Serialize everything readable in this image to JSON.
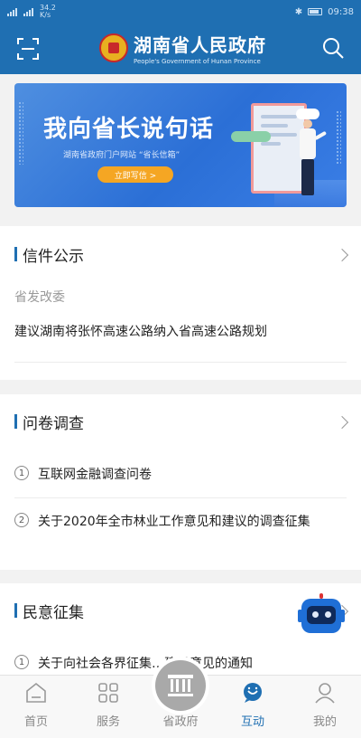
{
  "status_bar": {
    "time": "09:38",
    "left_info": "34.2 K/s"
  },
  "header": {
    "title": "湖南省人民政府",
    "subtitle": "People's Government of Hunan Province"
  },
  "banner": {
    "title": "我向省长说句话",
    "subtitle": "湖南省政府门户网站 “省长信箱”",
    "button": "立即写信 >"
  },
  "letters": {
    "title": "信件公示",
    "department": "省发改委",
    "item": "建议湖南将张怀高速公路纳入省高速公路规划"
  },
  "survey": {
    "title": "问卷调查",
    "items": [
      {
        "num": "1",
        "text": "互联网金融调查问卷"
      },
      {
        "num": "2",
        "text": "关于2020年全市林业工作意见和建议的调查征集"
      }
    ]
  },
  "opinion": {
    "title": "民意征集",
    "items": [
      {
        "num": "1",
        "text": "关于向社会各界征集…建设意见的通知"
      }
    ]
  },
  "nav": {
    "items": [
      {
        "label": "首页",
        "icon": "home-icon"
      },
      {
        "label": "服务",
        "icon": "grid-icon"
      },
      {
        "label": "省政府",
        "icon": "building-icon"
      },
      {
        "label": "互动",
        "icon": "chat-icon"
      },
      {
        "label": "我的",
        "icon": "user-icon"
      }
    ],
    "active": "互动"
  },
  "colors": {
    "primary": "#1f6fb2",
    "accent": "#f5a623"
  }
}
